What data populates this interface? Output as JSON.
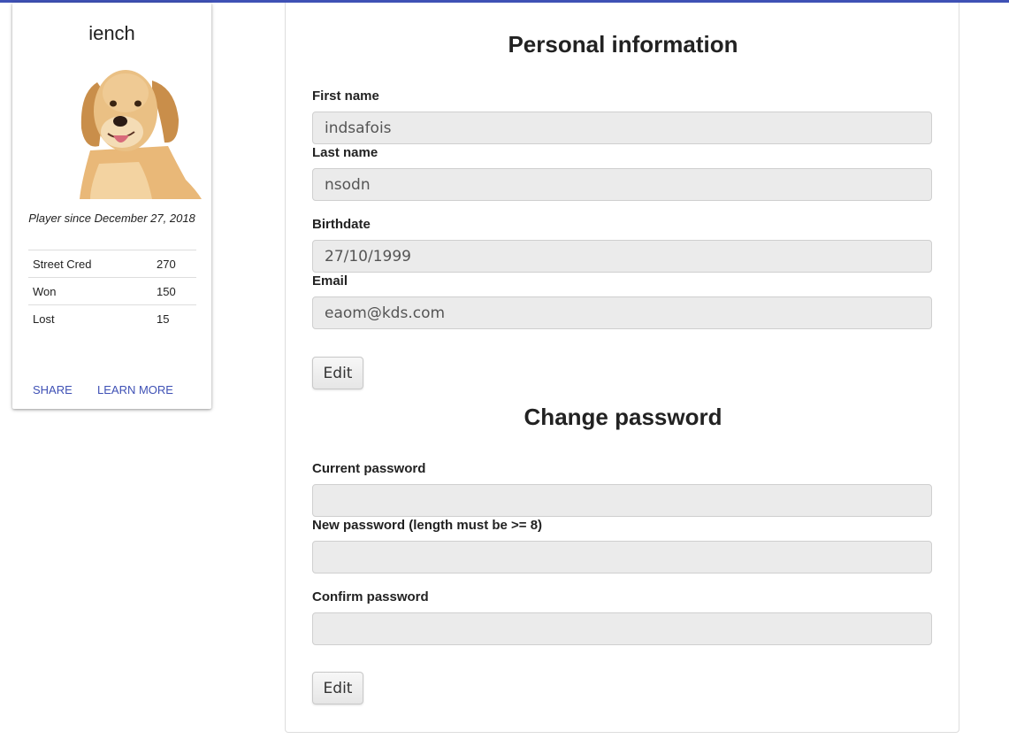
{
  "profile": {
    "username": "iench",
    "avatar_alt": "golden retriever",
    "player_since": "Player since December 27, 2018",
    "stats": [
      {
        "label": "Street Cred",
        "value": "270"
      },
      {
        "label": "Won",
        "value": "150"
      },
      {
        "label": "Lost",
        "value": "15"
      }
    ],
    "actions": {
      "share": "SHARE",
      "learn_more": "LEARN MORE"
    }
  },
  "personal": {
    "title": "Personal information",
    "first_name_label": "First name",
    "first_name_value": "indsafois",
    "last_name_label": "Last name",
    "last_name_value": "nsodn",
    "birthdate_label": "Birthdate",
    "birthdate_value": "27/10/1999",
    "email_label": "Email",
    "email_value": "eaom@kds.com",
    "edit_label": "Edit"
  },
  "password": {
    "title": "Change password",
    "current_label": "Current password",
    "current_value": "",
    "new_label": "New password (length must be >= 8)",
    "new_value": "",
    "confirm_label": "Confirm password",
    "confirm_value": "",
    "edit_label": "Edit"
  },
  "colors": {
    "accent": "#3f51b5",
    "input_bg": "#ebebeb"
  }
}
